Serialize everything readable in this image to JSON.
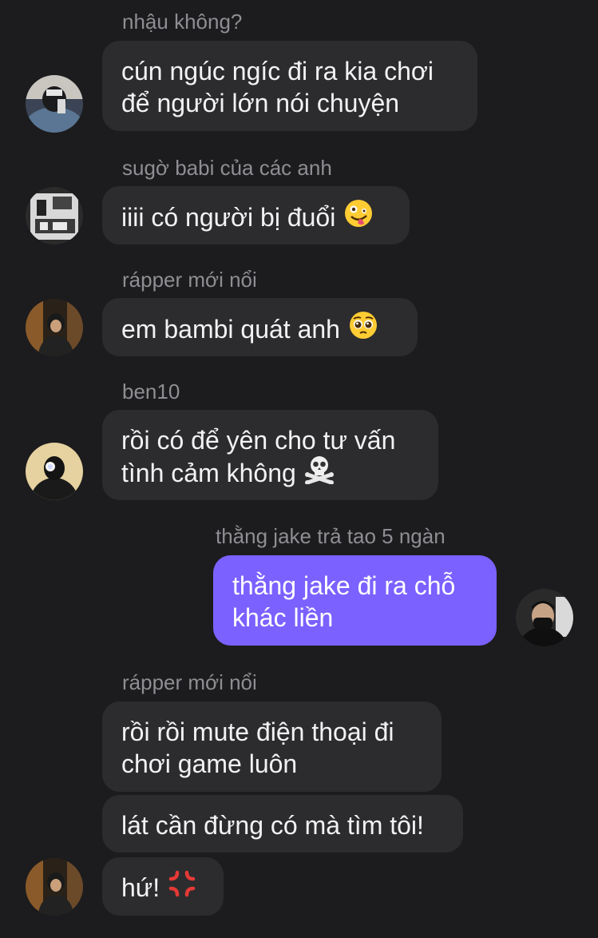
{
  "messages": [
    {
      "sender": "nhậu không?",
      "lines": [
        "cún ngúc ngíc đi ra kia chơi",
        "để người lớn nói chuyện"
      ]
    },
    {
      "sender": "sugờ babi của các anh",
      "lines": [
        "iiii có người bị đuổi"
      ],
      "emoji": "zany-face-icon"
    },
    {
      "sender": "rápper mới nổi",
      "lines": [
        "em bambi quát anh"
      ],
      "emoji": "pleading-face-icon"
    },
    {
      "sender": "ben10",
      "lines": [
        "rồi có để yên cho tư vấn",
        "tình cảm không"
      ],
      "emoji": "skull-crossbones-icon"
    },
    {
      "sender": "thằng jake trả tao 5 ngàn",
      "lines": [
        "thằng jake đi ra chỗ",
        "khác liền"
      ],
      "self": true
    },
    {
      "sender": "rápper mới nổi",
      "lines": [
        "rồi rồi mute điện thoại đi",
        "chơi game luôn"
      ]
    },
    {
      "lines": [
        "lát cần đừng có mà tìm tôi!"
      ]
    },
    {
      "lines": [
        "hứ!"
      ],
      "emoji": "anger-symbol-icon"
    }
  ],
  "colors": {
    "background": "#1c1c1e",
    "bubble_other": "#2c2c2e",
    "bubble_self": "#7b61ff",
    "sender_name": "#8e8e93",
    "text": "#f2f2f4"
  }
}
